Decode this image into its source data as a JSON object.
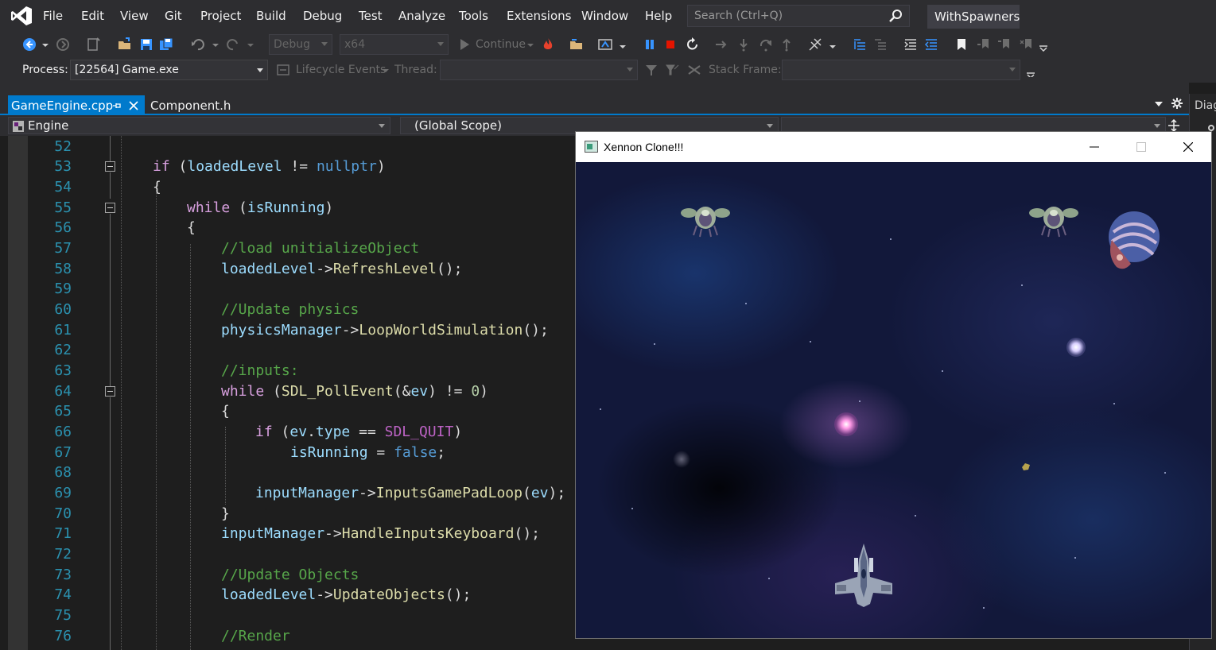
{
  "menubar": {
    "items": [
      "File",
      "Edit",
      "View",
      "Git",
      "Project",
      "Build",
      "Debug",
      "Test",
      "Analyze",
      "Tools",
      "Extensions",
      "Window",
      "Help"
    ],
    "search_placeholder": "Search (Ctrl+Q)",
    "solution_name": "WithSpawners"
  },
  "toolbar": {
    "config": "Debug",
    "platform": "x64",
    "continue_label": "Continue",
    "process_label": "Process:",
    "process_value": "[22564] Game.exe",
    "lifecycle_label": "Lifecycle Events",
    "thread_label": "Thread:",
    "stack_frame_label": "Stack Frame:"
  },
  "tabs": {
    "active": "GameEngine.cpp",
    "other": "Component.h",
    "right_panel": "Diag"
  },
  "navbar": {
    "project": "Engine",
    "scope": "(Global Scope)"
  },
  "editor": {
    "line_numbers": [
      "52",
      "53",
      "54",
      "55",
      "56",
      "57",
      "58",
      "59",
      "60",
      "61",
      "62",
      "63",
      "64",
      "65",
      "66",
      "67",
      "68",
      "69",
      "70",
      "71",
      "72",
      "73",
      "74",
      "75",
      "76"
    ],
    "code": {
      "l53": {
        "kw": "if",
        "p1": " (",
        "var": "loadedLevel",
        "op": " != ",
        "lit": "nullptr",
        "p2": ")"
      },
      "l54": "{",
      "l55": {
        "kw": "while",
        "p1": " (",
        "var": "isRunning",
        "p2": ")"
      },
      "l56": "{",
      "l57": "//load unitializeObject",
      "l58": {
        "obj": "loadedLevel",
        "arrow": "->",
        "fn": "RefreshLevel",
        "rest": "();"
      },
      "l60": "//Update physics",
      "l61": {
        "obj": "physicsManager",
        "arrow": "->",
        "fn": "LoopWorldSimulation",
        "rest": "();"
      },
      "l63": "//inputs:",
      "l64": {
        "kw": "while",
        "p1": " (",
        "fn": "SDL_PollEvent",
        "p2": "(&",
        "var": "ev",
        "p3": ") != ",
        "num": "0",
        "p4": ")"
      },
      "l65": "{",
      "l66": {
        "kw": "if",
        "p1": " (",
        "var": "ev",
        "p2": ".",
        "field": "type",
        "op": " == ",
        "mac": "SDL_QUIT",
        "p3": ")"
      },
      "l67": {
        "var": "isRunning",
        "op": " = ",
        "lit": "false",
        "p": ";"
      },
      "l69": {
        "obj": "inputManager",
        "arrow": "->",
        "fn": "InputsGamePadLoop",
        "p1": "(",
        "var": "ev",
        "p2": ");"
      },
      "l70": "}",
      "l71": {
        "obj": "inputManager",
        "arrow": "->",
        "fn": "HandleInputsKeyboard",
        "rest": "();"
      },
      "l73": "//Update Objects",
      "l74": {
        "obj": "loadedLevel",
        "arrow": "->",
        "fn": "UpdateObjects",
        "rest": "();"
      },
      "l76": "//Render"
    }
  },
  "game_window": {
    "title": "Xennon Clone!!!"
  },
  "colors": {
    "accent": "#007acc",
    "keyword": "#569cd6",
    "control": "#d8a0df",
    "comment": "#57a64a",
    "function": "#dcdcaa",
    "variable": "#9cdcfe",
    "line_number": "#2b91af"
  }
}
